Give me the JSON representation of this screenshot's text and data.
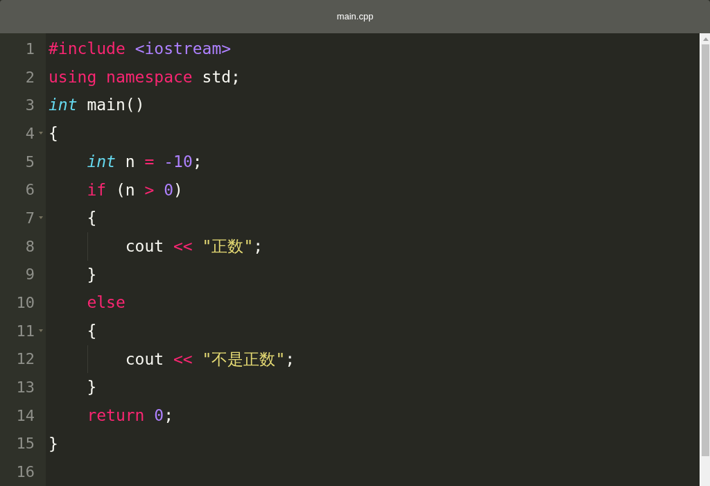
{
  "window": {
    "title": "main.cpp"
  },
  "editor": {
    "lines": [
      {
        "number": "1",
        "foldable": false,
        "tokens": [
          {
            "kind": "keyword",
            "text": "#include "
          },
          {
            "kind": "number",
            "text": "<iostream>"
          }
        ]
      },
      {
        "number": "2",
        "foldable": false,
        "tokens": [
          {
            "kind": "keyword",
            "text": "using namespace "
          },
          {
            "kind": "plain",
            "text": "std;"
          }
        ]
      },
      {
        "number": "3",
        "foldable": false,
        "tokens": [
          {
            "kind": "type",
            "text": "int"
          },
          {
            "kind": "plain",
            "text": " main()"
          }
        ]
      },
      {
        "number": "4",
        "foldable": true,
        "tokens": [
          {
            "kind": "plain",
            "text": "{"
          }
        ]
      },
      {
        "number": "5",
        "foldable": false,
        "tokens": [
          {
            "kind": "type",
            "text": "    int"
          },
          {
            "kind": "plain",
            "text": " n "
          },
          {
            "kind": "keyword",
            "text": "= "
          },
          {
            "kind": "number",
            "text": "-10"
          },
          {
            "kind": "plain",
            "text": ";"
          }
        ]
      },
      {
        "number": "6",
        "foldable": false,
        "tokens": [
          {
            "kind": "keyword",
            "text": "    if"
          },
          {
            "kind": "plain",
            "text": " (n "
          },
          {
            "kind": "keyword",
            "text": "> "
          },
          {
            "kind": "number",
            "text": "0"
          },
          {
            "kind": "plain",
            "text": ")"
          }
        ]
      },
      {
        "number": "7",
        "foldable": true,
        "tokens": [
          {
            "kind": "plain",
            "text": "    {"
          }
        ]
      },
      {
        "number": "8",
        "foldable": false,
        "tokens": [
          {
            "kind": "plain",
            "text": "        cout "
          },
          {
            "kind": "keyword",
            "text": "<< "
          },
          {
            "kind": "string",
            "text": "\"正数\""
          },
          {
            "kind": "plain",
            "text": ";"
          }
        ]
      },
      {
        "number": "9",
        "foldable": false,
        "tokens": [
          {
            "kind": "plain",
            "text": "    }"
          }
        ]
      },
      {
        "number": "10",
        "foldable": false,
        "tokens": [
          {
            "kind": "keyword",
            "text": "    else"
          }
        ]
      },
      {
        "number": "11",
        "foldable": true,
        "tokens": [
          {
            "kind": "plain",
            "text": "    {"
          }
        ]
      },
      {
        "number": "12",
        "foldable": false,
        "tokens": [
          {
            "kind": "plain",
            "text": "        cout "
          },
          {
            "kind": "keyword",
            "text": "<< "
          },
          {
            "kind": "string",
            "text": "\"不是正数\""
          },
          {
            "kind": "plain",
            "text": ";"
          }
        ]
      },
      {
        "number": "13",
        "foldable": false,
        "tokens": [
          {
            "kind": "plain",
            "text": "    }"
          }
        ]
      },
      {
        "number": "14",
        "foldable": false,
        "tokens": [
          {
            "kind": "keyword",
            "text": "    return "
          },
          {
            "kind": "number",
            "text": "0"
          },
          {
            "kind": "plain",
            "text": ";"
          }
        ]
      },
      {
        "number": "15",
        "foldable": false,
        "tokens": [
          {
            "kind": "plain",
            "text": "}"
          }
        ]
      },
      {
        "number": "16",
        "foldable": false
      }
    ]
  }
}
